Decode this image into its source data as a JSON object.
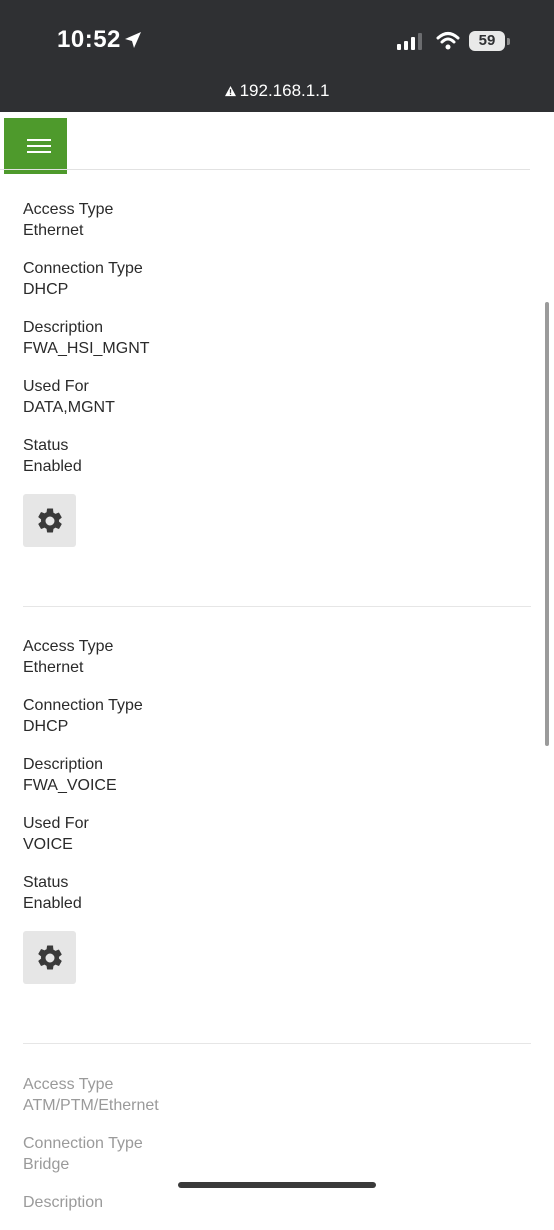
{
  "status_bar": {
    "time": "10:52",
    "battery": "59",
    "url": "192.168.1.1"
  },
  "records": [
    {
      "fields": [
        {
          "label": "Access Type",
          "value": "Ethernet"
        },
        {
          "label": "Connection Type",
          "value": "DHCP"
        },
        {
          "label": "Description",
          "value": "FWA_HSI_MGNT"
        },
        {
          "label": "Used For",
          "value": "DATA,MGNT"
        },
        {
          "label": "Status",
          "value": "Enabled"
        }
      ]
    },
    {
      "fields": [
        {
          "label": "Access Type",
          "value": "Ethernet"
        },
        {
          "label": "Connection Type",
          "value": "DHCP"
        },
        {
          "label": "Description",
          "value": "FWA_VOICE"
        },
        {
          "label": "Used For",
          "value": "VOICE"
        },
        {
          "label": "Status",
          "value": "Enabled"
        }
      ]
    },
    {
      "fields": [
        {
          "label": "Access Type",
          "value": "ATM/PTM/Ethernet"
        },
        {
          "label": "Connection Type",
          "value": "Bridge"
        },
        {
          "label": "Description",
          "value": ""
        }
      ]
    }
  ],
  "colors": {
    "menu_accent": "#4e9a2c",
    "status_bar_bg": "#2f3033",
    "disabled_text": "#9a9a9a"
  },
  "icons": [
    "location-arrow-icon",
    "signal-icon",
    "wifi-icon",
    "battery-icon",
    "warning-icon",
    "menu-icon",
    "gear-icon"
  ]
}
